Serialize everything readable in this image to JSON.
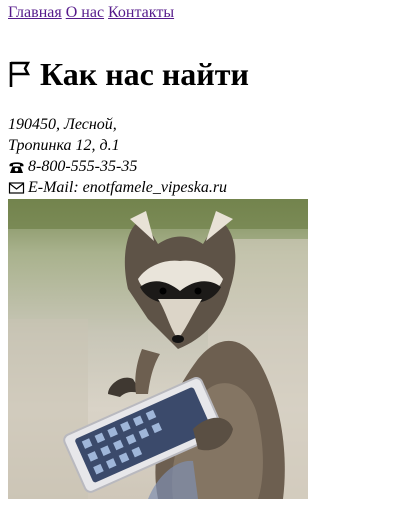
{
  "nav": {
    "links": [
      "Главная",
      "О нас",
      "Контакты"
    ]
  },
  "page_title": "Как нас найти",
  "address": {
    "line1": "190450, Лесной,",
    "line2": "Тропинка 12, д.1",
    "phone": "8-800-555-35-35",
    "email": "E-Mail: enotfamele_vipeska.ru"
  },
  "icons": {
    "title": "flag-icon",
    "phone": "phone-icon",
    "email": "envelope-icon"
  },
  "colors": {
    "link": "#1a0dab",
    "visited_link": "#551a8b"
  }
}
